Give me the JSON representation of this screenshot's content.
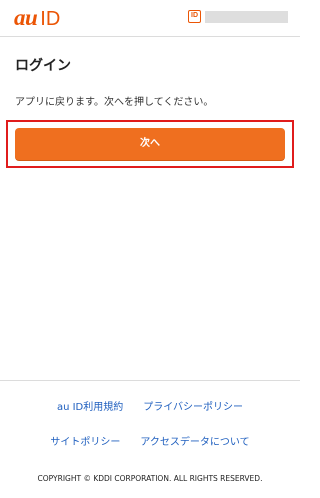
{
  "header": {
    "logo_au": "au",
    "logo_id": "ID",
    "account_icon": "id-badge-icon",
    "account_icon_text": "ID"
  },
  "main": {
    "title": "ログイン",
    "message": "アプリに戻ります。次へを押してください。",
    "next_button_label": "次へ"
  },
  "footer": {
    "links_row1": [
      "au ID利用規約",
      "プライバシーポリシー"
    ],
    "links_row2": [
      "サイトポリシー",
      "アクセスデータについて"
    ],
    "copyright": "COPYRIGHT © KDDI CORPORATION. ALL RIGHTS RESERVED."
  },
  "colors": {
    "brand_orange": "#eb5505",
    "button_orange": "#ef6f1f",
    "highlight_red": "#e01c1c",
    "link_blue": "#1f5fbf"
  }
}
